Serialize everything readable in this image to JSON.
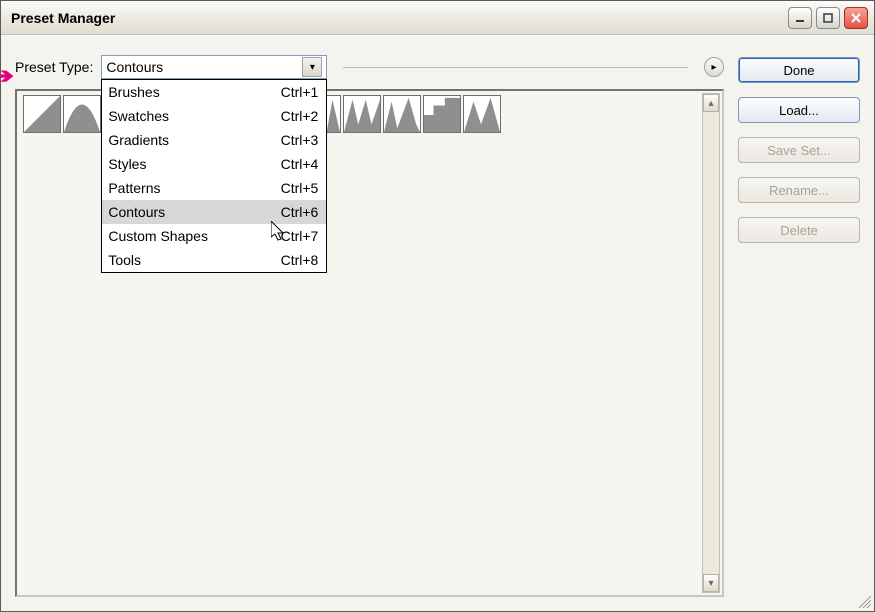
{
  "window": {
    "title": "Preset Manager"
  },
  "labels": {
    "preset_type": "Preset Type:"
  },
  "combo": {
    "selected": "Contours"
  },
  "dropdown_items": [
    {
      "label": "Brushes",
      "shortcut": "Ctrl+1",
      "selected": false
    },
    {
      "label": "Swatches",
      "shortcut": "Ctrl+2",
      "selected": false
    },
    {
      "label": "Gradients",
      "shortcut": "Ctrl+3",
      "selected": false
    },
    {
      "label": "Styles",
      "shortcut": "Ctrl+4",
      "selected": false
    },
    {
      "label": "Patterns",
      "shortcut": "Ctrl+5",
      "selected": false
    },
    {
      "label": "Contours",
      "shortcut": "Ctrl+6",
      "selected": true
    },
    {
      "label": "Custom Shapes",
      "shortcut": "Ctrl+7",
      "selected": false
    },
    {
      "label": "Tools",
      "shortcut": "Ctrl+8",
      "selected": false
    }
  ],
  "buttons": {
    "done": {
      "label": "Done",
      "enabled": true
    },
    "load": {
      "label": "Load...",
      "enabled": true
    },
    "saveset": {
      "label": "Save Set...",
      "enabled": false
    },
    "rename": {
      "label": "Rename...",
      "enabled": false
    },
    "delete": {
      "label": "Delete",
      "enabled": false
    }
  },
  "contour_thumbs": [
    "linear",
    "cone",
    "cone-inverted",
    "cove-deep",
    "cove-shallow",
    "gaussian",
    "half-round",
    "ring",
    "ring-double",
    "rolling-slope-descending",
    "rounded-steps",
    "sawtooth1"
  ],
  "colors": {
    "annotation_arrow": "#e6007e",
    "thumb_fill": "#8f8f8f"
  }
}
